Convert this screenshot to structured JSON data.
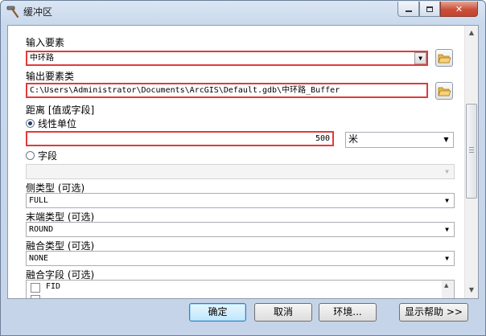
{
  "window": {
    "title": "缓冲区"
  },
  "form": {
    "input_features": {
      "label": "输入要素",
      "value": "中环路"
    },
    "output_class": {
      "label": "输出要素类",
      "value": "C:\\Users\\Administrator\\Documents\\ArcGIS\\Default.gdb\\中环路_Buffer"
    },
    "distance": {
      "label": "距离 [值或字段]",
      "linear_unit_label": "线性单位",
      "linear_unit_selected": true,
      "value": "500",
      "unit": "米",
      "field_label": "字段",
      "field_selected": false,
      "field_value": ""
    },
    "side_type": {
      "label": "侧类型 (可选)",
      "value": "FULL"
    },
    "end_type": {
      "label": "末端类型 (可选)",
      "value": "ROUND"
    },
    "dissolve_type": {
      "label": "融合类型 (可选)",
      "value": "NONE"
    },
    "dissolve_fields": {
      "label": "融合字段 (可选)",
      "items": [
        "FID"
      ]
    }
  },
  "buttons": {
    "ok": "确定",
    "cancel": "取消",
    "environments": "环境...",
    "show_help": "显示帮助 >>"
  }
}
